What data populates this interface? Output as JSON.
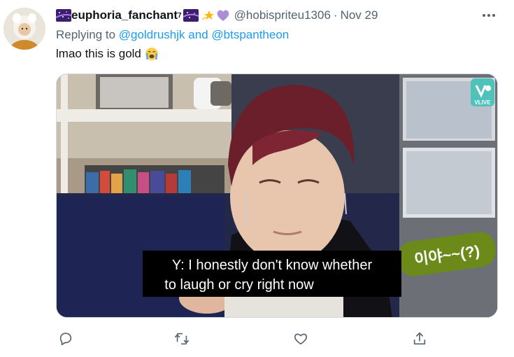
{
  "tweet": {
    "display_name": "euphoria_fanchant",
    "name_superscript": "7",
    "handle": "@hobispriteu1306",
    "separator": "·",
    "date": "Nov 29",
    "replying_prefix": "Replying to",
    "reply_user_1": "@goldrushjk",
    "reply_and": "and",
    "reply_user_2": "@btspantheon",
    "text": "lmao this is gold",
    "text_emoji": "loudly-crying-face-emoji"
  },
  "media": {
    "subtitle_line_1": "Y: I honestly don't know whether",
    "subtitle_line_2": "to laugh or cry right now",
    "sticker_text": "이야~~(?)",
    "watermark_label": "VLIVE"
  },
  "actions": {
    "reply": "reply-icon",
    "retweet": "retweet-icon",
    "like": "like-icon",
    "share": "share-icon"
  },
  "colors": {
    "link": "#1d9bf0",
    "secondary_text": "#536471",
    "primary_text": "#0f1419",
    "subtitle_bg": "#000000",
    "sticker_bg": "#6b8a1a",
    "vlive": "#4fc3ba"
  }
}
